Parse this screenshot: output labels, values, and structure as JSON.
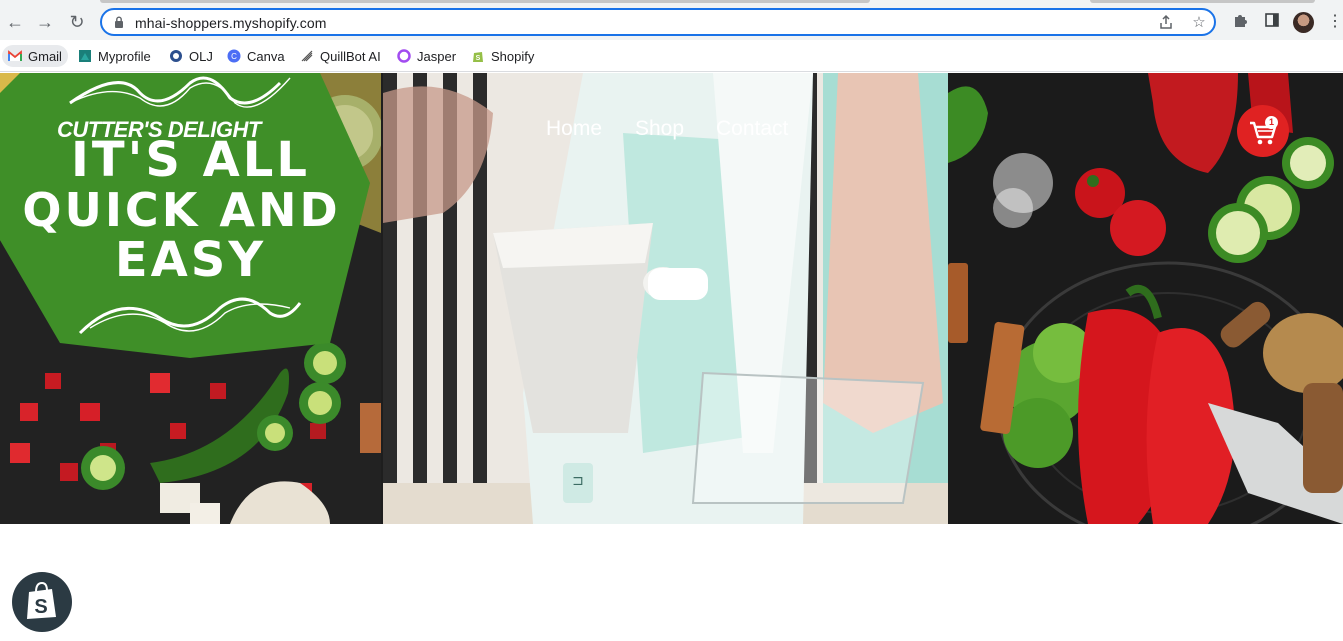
{
  "browser": {
    "url": "mhai-shoppers.myshopify.com",
    "bookmarks": [
      {
        "label": "Gmail",
        "icon": "gmail-icon"
      },
      {
        "label": "Myprofile",
        "icon": "myprofile-icon"
      },
      {
        "label": "OLJ",
        "icon": "olj-icon"
      },
      {
        "label": "Canva",
        "icon": "canva-icon"
      },
      {
        "label": "QuillBot AI",
        "icon": "quillbot-icon"
      },
      {
        "label": "Jasper",
        "icon": "jasper-icon"
      },
      {
        "label": "Shopify",
        "icon": "shopify-icon"
      }
    ]
  },
  "site": {
    "brand": "CUTTER'S DELIGHT",
    "nav": [
      "Home",
      "Shop",
      "Contact"
    ],
    "cart_count": "1",
    "banner_lines": [
      "IT'S ALL",
      "QUICK AND",
      "EASY"
    ],
    "colors": {
      "banner_green": "#3f8f28",
      "cart_red": "#e02222",
      "accent_blue": "#1a73e8"
    }
  }
}
